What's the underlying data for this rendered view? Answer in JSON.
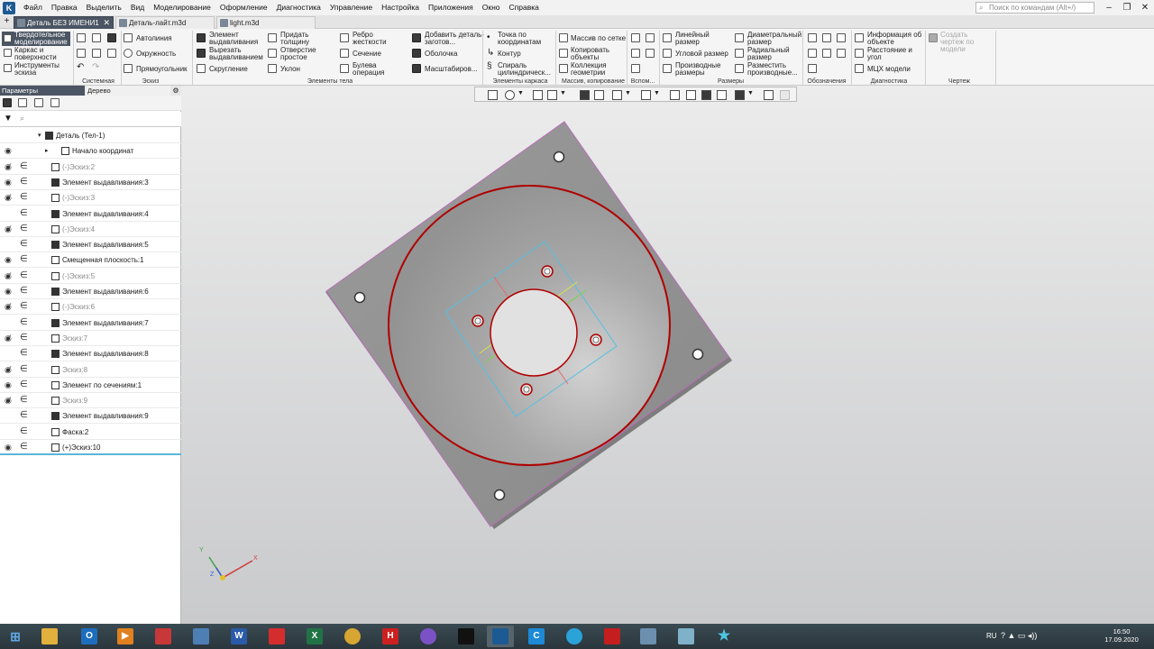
{
  "menu": {
    "items": [
      "Файл",
      "Правка",
      "Выделить",
      "Вид",
      "Моделирование",
      "Оформление",
      "Диагностика",
      "Управление",
      "Настройка",
      "Приложения",
      "Окно",
      "Справка"
    ],
    "search_placeholder": "Поиск по командам (Alt+/)"
  },
  "tabs": [
    {
      "label": "Деталь БЕЗ ИМЕНИ1",
      "active": true
    },
    {
      "label": "Деталь-лайт.m3d",
      "active": false
    },
    {
      "label": "light.m3d",
      "active": false
    }
  ],
  "modes": {
    "active": "Твердотельное моделирование",
    "wireframe": "Каркас и поверхности",
    "sketch_tools": "Инструменты эскиза"
  },
  "ribbon": {
    "system": {
      "label": "Системная"
    },
    "sketch": {
      "label": "Эскиз",
      "autoline": "Автолиния",
      "circle": "Окружность",
      "rectangle": "Прямоугольник"
    },
    "body": {
      "label": "Элементы тела",
      "extrude": "Элемент выдавливания",
      "cut_extrude": "Вырезать выдавливанием",
      "fillet": "Скругление",
      "thickness": "Придать толщину",
      "hole": "Отверстие простое",
      "draft": "Уклон",
      "rib": "Ребро жесткости",
      "section": "Сечение",
      "boolean": "Булева операция",
      "add_blank": "Добавить деталь-заготов...",
      "shell": "Оболочка",
      "scale": "Масштабиров..."
    },
    "frame": {
      "label": "Элементы каркаса",
      "point": "Точка по координатам",
      "contour": "Контур",
      "spiral": "Спираль цилиндрическ..."
    },
    "array": {
      "label": "Массив, копирование",
      "grid": "Массив по сетке",
      "copy": "Копировать объекты",
      "collection": "Коллекция геометрии"
    },
    "aux": {
      "label": "Вспом..."
    },
    "dims": {
      "label": "Размеры",
      "linear": "Линейный размер",
      "angular": "Угловой размер",
      "derived": "Производные размеры",
      "diametral": "Диаметральный размер",
      "radial": "Радиальный размер",
      "place": "Разместить производные..."
    },
    "notation": {
      "label": "Обозначения"
    },
    "diag": {
      "label": "Диагностика",
      "info": "Информация об объекте",
      "distance": "Расстояние и угол",
      "mcc": "МЦХ модели"
    },
    "drawing": {
      "label": "Чертеж",
      "create": "Создать чертеж по модели"
    }
  },
  "panel": {
    "tab_params": "Параметры",
    "tab_tree": "Дерево",
    "rows": [
      {
        "label": "Деталь (Тел-1)",
        "gray": false,
        "eye": false,
        "eps": false,
        "indent": 62,
        "icon": "part-icon"
      },
      {
        "label": "Начало координат",
        "gray": false,
        "eye": true,
        "eps": false,
        "indent": 80,
        "icon": "origin-icon"
      },
      {
        "label": "(-)Эскиз:2",
        "gray": true,
        "eye": "hidden",
        "eps": true,
        "indent": 69,
        "icon": "sketch-icon"
      },
      {
        "label": "Элемент выдавливания:3",
        "gray": false,
        "eye": true,
        "eps": true,
        "indent": 69,
        "icon": "extrude-icon"
      },
      {
        "label": "(-)Эскиз:3",
        "gray": true,
        "eye": "hidden",
        "eps": true,
        "indent": 69,
        "icon": "sketch-icon"
      },
      {
        "label": "Элемент выдавливания:4",
        "gray": false,
        "eye": false,
        "eps": true,
        "indent": 69,
        "icon": "extrude-icon"
      },
      {
        "label": "(-)Эскиз:4",
        "gray": true,
        "eye": "hidden",
        "eps": true,
        "indent": 69,
        "icon": "sketch-icon"
      },
      {
        "label": "Элемент выдавливания:5",
        "gray": false,
        "eye": false,
        "eps": true,
        "indent": 69,
        "icon": "extrude-icon"
      },
      {
        "label": "Смещенная плоскость:1",
        "gray": false,
        "eye": true,
        "eps": true,
        "indent": 69,
        "icon": "plane-icon"
      },
      {
        "label": "(-)Эскиз:5",
        "gray": true,
        "eye": "hidden",
        "eps": true,
        "indent": 69,
        "icon": "sketch-icon"
      },
      {
        "label": "Элемент выдавливания:6",
        "gray": false,
        "eye": true,
        "eps": true,
        "indent": 69,
        "icon": "extrude-icon"
      },
      {
        "label": "(-)Эскиз:6",
        "gray": true,
        "eye": "hidden",
        "eps": true,
        "indent": 69,
        "icon": "sketch-icon"
      },
      {
        "label": "Элемент выдавливания:7",
        "gray": false,
        "eye": false,
        "eps": true,
        "indent": 69,
        "icon": "extrude-icon"
      },
      {
        "label": "Эскиз:7",
        "gray": true,
        "eye": "hidden",
        "eps": true,
        "indent": 69,
        "icon": "sketch-icon"
      },
      {
        "label": "Элемент выдавливания:8",
        "gray": false,
        "eye": false,
        "eps": true,
        "indent": 69,
        "icon": "extrude-icon"
      },
      {
        "label": "Эскиз:8",
        "gray": true,
        "eye": "hidden",
        "eps": true,
        "indent": 69,
        "icon": "sketch-icon"
      },
      {
        "label": "Элемент по сечениям:1",
        "gray": false,
        "eye": true,
        "eps": true,
        "indent": 69,
        "icon": "loft-icon"
      },
      {
        "label": "Эскиз:9",
        "gray": true,
        "eye": "hidden",
        "eps": true,
        "indent": 69,
        "icon": "sketch-icon"
      },
      {
        "label": "Элемент выдавливания:9",
        "gray": false,
        "eye": false,
        "eps": true,
        "indent": 69,
        "icon": "extrude-icon"
      },
      {
        "label": "Фаска:2",
        "gray": false,
        "eye": false,
        "eps": true,
        "indent": 69,
        "icon": "chamfer-icon"
      },
      {
        "label": "(+)Эскиз:10",
        "gray": false,
        "eye": true,
        "eps": true,
        "indent": 69,
        "icon": "sketch-icon"
      }
    ]
  },
  "axes": {
    "x": "X",
    "y": "Y",
    "z": "Z"
  },
  "taskbar": {
    "lang": "RU",
    "time": "16:50",
    "date": "17.09.2020"
  },
  "colors": {
    "accent": "#4b5563",
    "selection": "#5ab6d8",
    "edge": "#b00000"
  }
}
